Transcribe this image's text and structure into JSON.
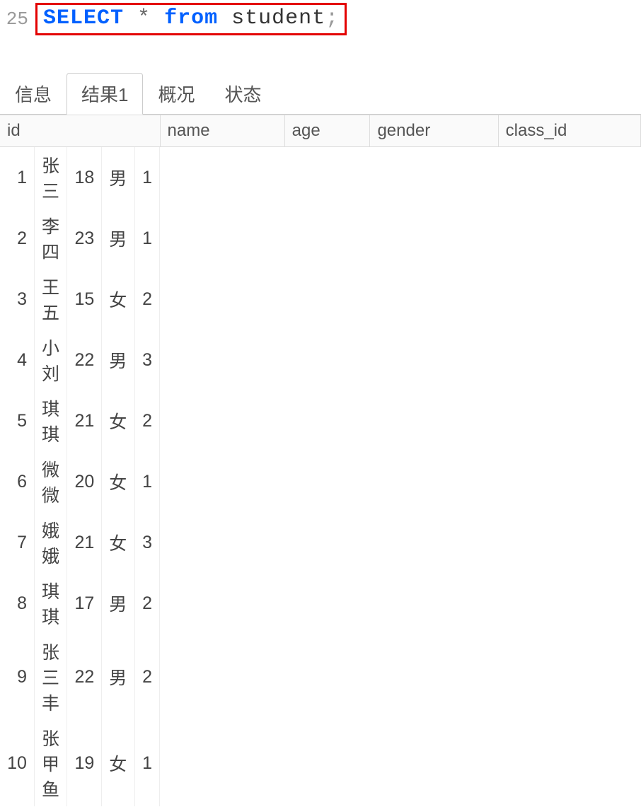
{
  "editor": {
    "line_number": "25",
    "sql": {
      "select": "SELECT",
      "star": "*",
      "from": "from",
      "table": "student",
      "semicolon": ";"
    }
  },
  "tabs": [
    {
      "label": "信息",
      "active": false
    },
    {
      "label": "结果1",
      "active": true
    },
    {
      "label": "概况",
      "active": false
    },
    {
      "label": "状态",
      "active": false
    }
  ],
  "table": {
    "columns": [
      "id",
      "name",
      "age",
      "gender",
      "class_id"
    ],
    "rows": [
      {
        "id": "1",
        "name": "张三",
        "age": "18",
        "gender": "男",
        "class_id": "1"
      },
      {
        "id": "2",
        "name": "李四",
        "age": "23",
        "gender": "男",
        "class_id": "1"
      },
      {
        "id": "3",
        "name": "王五",
        "age": "15",
        "gender": "女",
        "class_id": "2"
      },
      {
        "id": "4",
        "name": "小刘",
        "age": "22",
        "gender": "男",
        "class_id": "3"
      },
      {
        "id": "5",
        "name": "琪琪",
        "age": "21",
        "gender": "女",
        "class_id": "2"
      },
      {
        "id": "6",
        "name": "微微",
        "age": "20",
        "gender": "女",
        "class_id": "1"
      },
      {
        "id": "7",
        "name": "娥娥",
        "age": "21",
        "gender": "女",
        "class_id": "3"
      },
      {
        "id": "8",
        "name": "琪琪",
        "age": "17",
        "gender": "男",
        "class_id": "2"
      },
      {
        "id": "9",
        "name": "张三丰",
        "age": "22",
        "gender": "男",
        "class_id": "2"
      },
      {
        "id": "10",
        "name": "张甲鱼",
        "age": "19",
        "gender": "女",
        "class_id": "1"
      }
    ]
  }
}
